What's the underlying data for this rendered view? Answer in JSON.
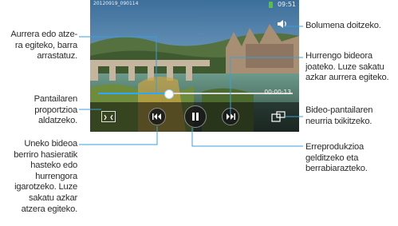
{
  "player": {
    "file_name": "20120919_090114",
    "clock": "09:51",
    "elapsed": "00:00:13",
    "progress": 0.36
  },
  "icons": {
    "volume": "volume-icon",
    "aspect": "aspect-ratio-icon",
    "prev": "rewind-icon",
    "pause": "pause-icon",
    "next": "fast-forward-icon",
    "popup": "popup-resize-icon"
  },
  "callouts": {
    "seek": [
      "Aurrera edo atze-",
      "ra egiteko, barra",
      "arrastatuz."
    ],
    "aspect": [
      "Pantailaren",
      "proportzioa",
      "aldatzeko."
    ],
    "prev": [
      "Uneko bideoa",
      "berriro hasieratik",
      "hasteko edo",
      "hurrengora",
      "igarotzeko. Luze",
      "sakatu azkar",
      "atzera egiteko."
    ],
    "volume": [
      "Bolumena doitzeko."
    ],
    "next": [
      "Hurrengo bideora",
      "joateko. Luze sakatu",
      "azkar aurrera egiteko."
    ],
    "popup": [
      "Bideo-pantailaren",
      "neurria txikitzeko."
    ],
    "pause": [
      "Erreprodukzioa",
      "gelditzeko eta",
      "berrabiarazteko."
    ]
  },
  "colors": {
    "accent": "#29a8ff",
    "callout_line": "#3aa0d8"
  }
}
